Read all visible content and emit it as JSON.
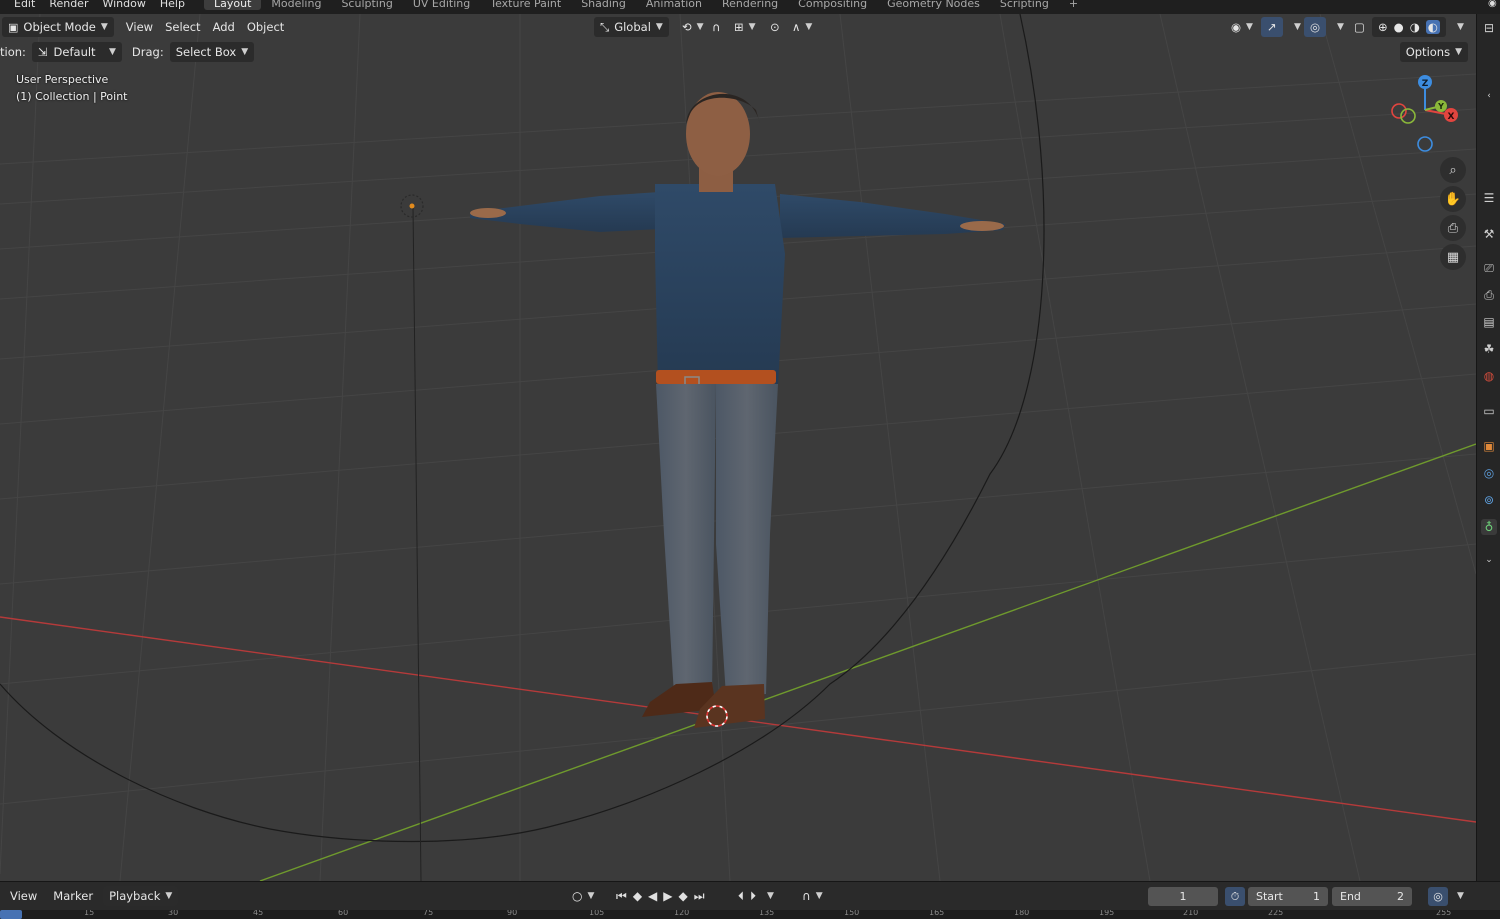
{
  "topbar": {
    "menus": [
      "Edit",
      "Render",
      "Window",
      "Help"
    ],
    "workspaces": [
      "Layout",
      "Modeling",
      "Sculpting",
      "UV Editing",
      "Texture Paint",
      "Shading",
      "Animation",
      "Rendering",
      "Compositing",
      "Geometry Nodes",
      "Scripting"
    ],
    "active_workspace": "Layout",
    "add_tab": "+"
  },
  "header": {
    "mode": "Object Mode",
    "menus": [
      "View",
      "Select",
      "Add",
      "Object"
    ],
    "transform_orientation": "Global"
  },
  "toolsettings": {
    "orientation_label": "tion:",
    "orientation_value": "Default",
    "drag_label": "Drag:",
    "drag_value": "Select Box",
    "options": "Options"
  },
  "viewport": {
    "perspective": "User Perspective",
    "collection": "(1) Collection | Point",
    "gizmo_axes": [
      "Z",
      "Y",
      "X"
    ],
    "axis_colors": {
      "x": "#e2453f",
      "y": "#8bb83a",
      "z": "#3d8de0"
    }
  },
  "timeline": {
    "menus": [
      "View",
      "Marker",
      "Playback"
    ],
    "current_frame": "1",
    "start_label": "Start",
    "start_value": "1",
    "end_label": "End",
    "end_value": "2",
    "ruler_ticks": [
      "15",
      "30",
      "45",
      "60",
      "75",
      "90",
      "105",
      "120",
      "135",
      "150",
      "165",
      "180",
      "195",
      "210",
      "225",
      "255"
    ],
    "ruler_current": "1"
  },
  "icons": {
    "zoom": "magnifier-plus-icon",
    "pan": "hand-icon",
    "camera": "camera-view-icon",
    "ortho": "grid-view-icon"
  }
}
